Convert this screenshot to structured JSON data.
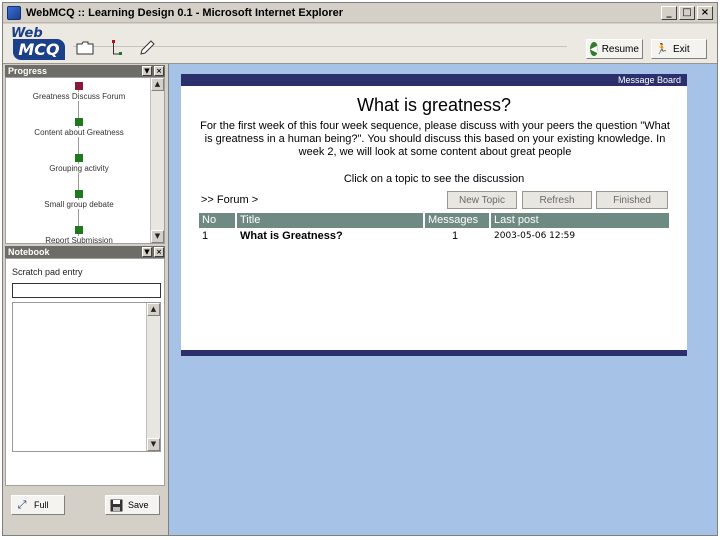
{
  "window": {
    "title": "WebMCQ :: Learning Design 0.1 - Microsoft Internet Explorer",
    "min_label": "_",
    "max_label": "□",
    "close_label": "×"
  },
  "toolbar": {
    "logo_top": "Web",
    "logo_bottom": "MCQ",
    "resume_label": "Resume",
    "exit_label": "Exit",
    "icons": [
      "folder-icon",
      "hierarchy-icon",
      "edit-icon"
    ]
  },
  "progress": {
    "header": "Progress",
    "items": [
      {
        "label": "Greatness Discuss Forum",
        "state": "current"
      },
      {
        "label": "Content about Greatness",
        "state": "done"
      },
      {
        "label": "Grouping activity",
        "state": "done"
      },
      {
        "label": "Small group debate",
        "state": "done"
      },
      {
        "label": "Report Submission",
        "state": "done"
      }
    ],
    "colors": {
      "current": "#8b1a3a",
      "done": "#1f7a1f"
    }
  },
  "notebook": {
    "header": "Notebook",
    "label": "Scratch pad entry",
    "input_value": "",
    "text_value": "",
    "full_label": "Full",
    "save_label": "Save"
  },
  "board": {
    "header": "Message Board",
    "title": "What is greatness?",
    "description": "For the first week of this four week sequence, please discuss with your peers the question \"What is greatness in a human being?\". You should discuss this based on your existing knowledge. In week 2, we will look at some content about great people",
    "instruction": "Click on a topic to see the discussion",
    "breadcrumb": ">> Forum >",
    "buttons": {
      "new_topic": "New Topic",
      "refresh": "Refresh",
      "finished": "Finished"
    },
    "table": {
      "headers": [
        "No",
        "Title",
        "Messages",
        "Last post"
      ],
      "rows": [
        {
          "no": "1",
          "title": "What is Greatness?",
          "messages": "1",
          "last_post": "2003-05-06 12:59"
        }
      ]
    },
    "colors": {
      "header_bg": "#2b2f6b",
      "table_header_bg": "#6f8a82",
      "background": "#a6c2e6"
    }
  }
}
